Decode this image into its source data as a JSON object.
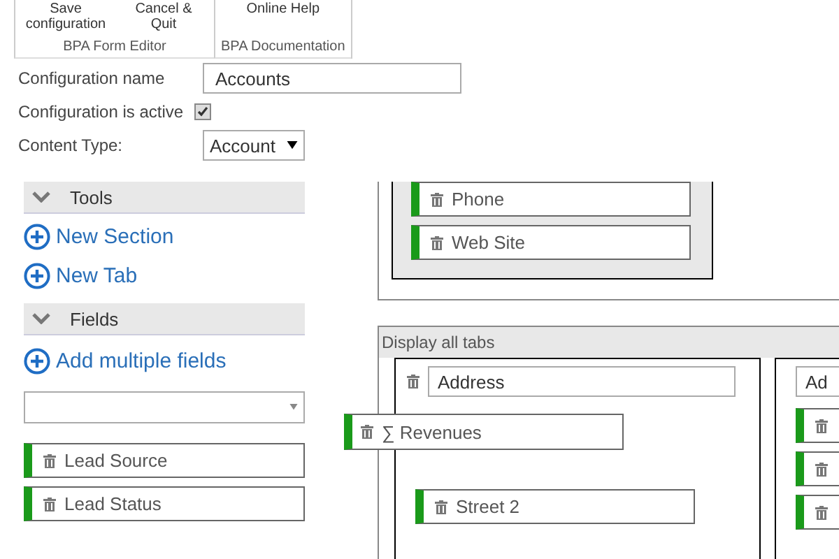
{
  "ribbon": {
    "groups": [
      {
        "label": "BPA Form Editor",
        "buttons": [
          "Save configuration",
          "Cancel & Quit"
        ]
      },
      {
        "label": "BPA Documentation",
        "buttons": [
          "Online Help"
        ]
      }
    ]
  },
  "form": {
    "name_label": "Configuration name",
    "name_value": "Accounts",
    "active_label": "Configuration is active",
    "active_checked": true,
    "type_label": "Content Type:",
    "type_value": "Account"
  },
  "tools": {
    "title": "Tools",
    "expanded": true,
    "actions": [
      "New Section",
      "New Tab"
    ]
  },
  "fields": {
    "title": "Fields",
    "expanded": true,
    "action": "Add multiple fields",
    "items": [
      "Lead Source",
      "Lead Status"
    ]
  },
  "top_section": {
    "fields": [
      "Phone",
      "Web Site"
    ]
  },
  "tabs_panel": {
    "title": "Display all tabs",
    "tabs": [
      {
        "name": "Address",
        "fields": [
          {
            "kind": "field",
            "label": "Street 2"
          }
        ]
      },
      {
        "name": "Ad",
        "fields": [
          {
            "kind": "field"
          },
          {
            "kind": "field"
          },
          {
            "kind": "field"
          }
        ]
      }
    ]
  },
  "dragged": {
    "label": "∑ Revenues"
  }
}
